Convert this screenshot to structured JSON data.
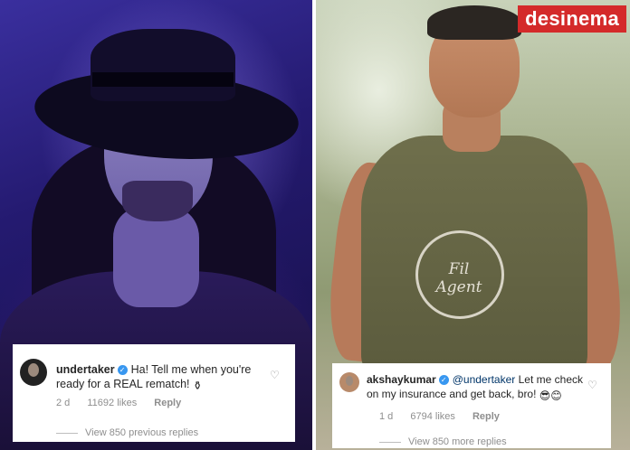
{
  "brand": {
    "logo_text": "desinema",
    "logo_color": "#d42a2a"
  },
  "left_photo": {
    "subject": "undertaker-photo",
    "print_text": ""
  },
  "right_photo": {
    "subject": "akshay-photo",
    "shirt_print": "Fil Agent"
  },
  "comments": [
    {
      "username": "undertaker",
      "verified": true,
      "text": "Ha! Tell me when you're ready for a REAL rematch!",
      "emoji": "coffin-icon",
      "time": "2 d",
      "likes": "11692 likes",
      "reply_label": "Reply",
      "view_replies": "View 850 previous replies"
    },
    {
      "username": "akshaykumar",
      "verified": true,
      "mention": "@undertaker",
      "text": "Let me check on my insurance and get back, bro!",
      "emoji": "sunglasses-smile-icons",
      "time": "1 d",
      "likes": "6794 likes",
      "reply_label": "Reply",
      "view_replies": "View 850 more replies"
    }
  ],
  "colors": {
    "accent_blue": "#3897f0",
    "meta_gray": "#8e8e8e"
  }
}
